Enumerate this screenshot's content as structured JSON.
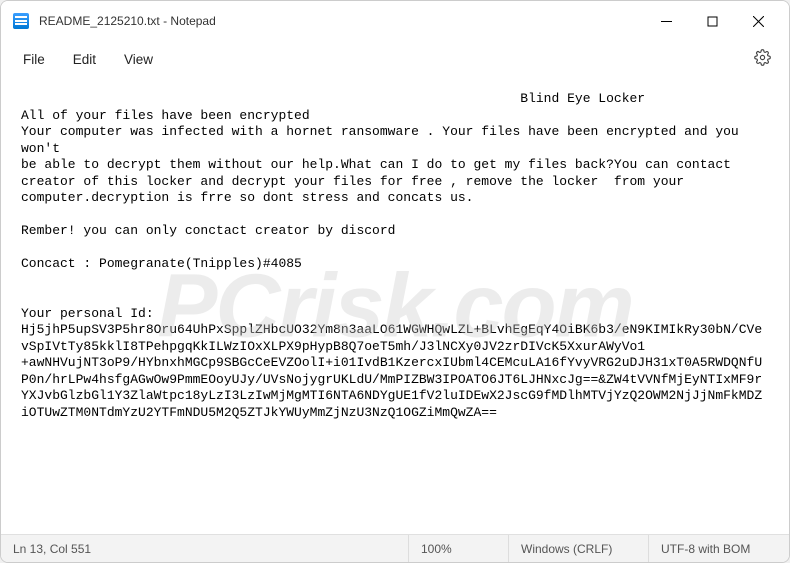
{
  "window": {
    "title": "README_2125210.txt - Notepad"
  },
  "menu": {
    "file": "File",
    "edit": "Edit",
    "view": "View"
  },
  "content": {
    "text": "                                                                Blind Eye Locker\nAll of your files have been encrypted\nYour computer was infected with a hornet ransomware . Your files have been encrypted and you won't\nbe able to decrypt them without our help.What can I do to get my files back?You can contact creator of this locker and decrypt your files for free , remove the locker  from your computer.decryption is frre so dont stress and concats us.\n\nRember! you can only conctact creator by discord\n\nConcact : Pomegranate(Tnipples)#4085\n\n\nYour personal Id:\nHj5jhP5upSV3P5hr8Oru64UhPxSpplZHbcUO32Ym8n3aaLO61WGWHQwLZL+BLvhEgEqY4OiBK6b3/eN9KIMIkRy30bN/CVevSpIVtTy85kklI8TPehpgqKkILWzIOxXLPX9pHypB8Q7oeT5mh/J3lNCXy0JV2zrDIVcK5XxurAWyVo1\n+awNHVujNT3oP9/HYbnxhMGCp9SBGcCeEVZOolI+i01IvdB1KzercxIUbml4CEMcuLA16fYvyVRG2uDJH31xT0A5RWDQNfUP0n/hrLPw4hsfgAGwOw9PmmEOoyUJy/UVsNojygrUKLdU/MmPIZBW3IPOATO6JT6LJHNxcJg==&ZW4tVVNfMjEyNTIxMF9rYXJvbGlzbGl1Y3ZlaWtpc18yLzI3LzIwMjMgMTI6NTA6NDYgUE1fV2luIDEwX2JscG9fMDlhMTVjYzQ2OWM2NjJjNmFkMDZiOTUwZTM0NTdmYzU2YTFmNDU5M2Q5ZTJkYWUyMmZjNzU3NzQ1OGZiMmQwZA=="
  },
  "statusbar": {
    "position": "Ln 13, Col 551",
    "zoom": "100%",
    "line_ending": "Windows (CRLF)",
    "encoding": "UTF-8 with BOM"
  },
  "watermark": "PCrisk.com"
}
